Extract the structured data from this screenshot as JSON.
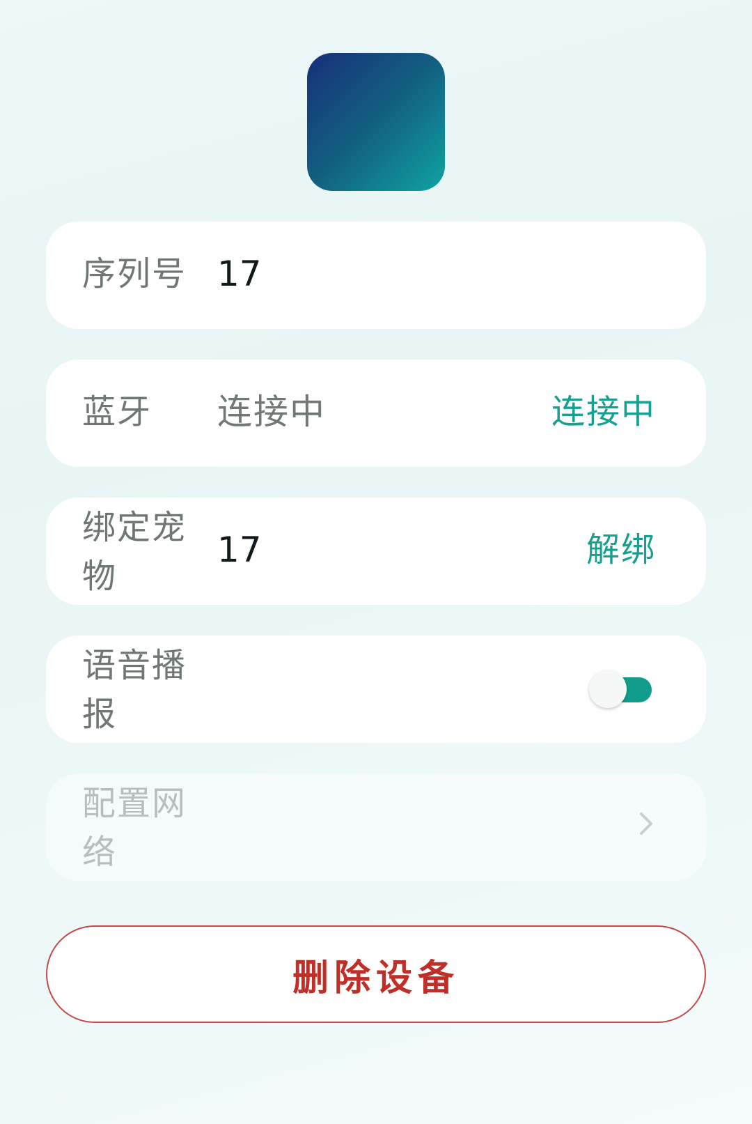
{
  "device": {
    "image_icon": "device-image-icon"
  },
  "rows": {
    "serial": {
      "label": "序列号",
      "value": "17"
    },
    "bluetooth": {
      "label": "蓝牙",
      "value": "连接中",
      "action": "连接中"
    },
    "bind_pet": {
      "label": "绑定宠物",
      "value": "17",
      "action": "解绑"
    },
    "voice": {
      "label": "语音播报",
      "toggle_on": true
    },
    "network": {
      "label": "配置网络",
      "icon": "chevron-right-icon"
    }
  },
  "delete_button": {
    "label": "删除设备"
  },
  "colors": {
    "accent": "#15A090",
    "danger": "#BF2F28",
    "label": "#6F7775",
    "value": "#111A1A"
  }
}
